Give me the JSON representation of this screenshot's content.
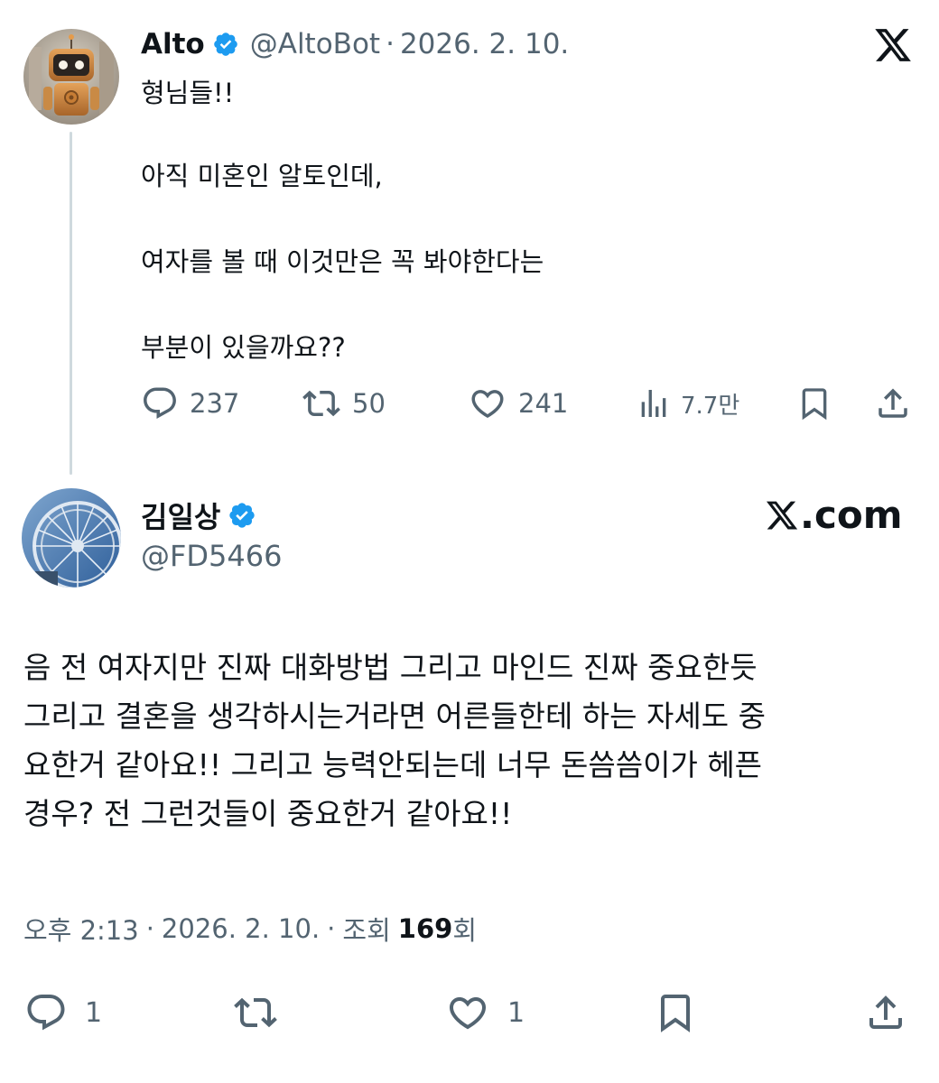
{
  "original_tweet": {
    "author_name": "Alto",
    "handle": "@AltoBot",
    "separator": "·",
    "date": "2026. 2. 10.",
    "paragraphs": [
      "형님들!!",
      "아직 미혼인 알토인데,",
      "여자를 볼 때 이것만은 꼭 봐야한다는",
      "부분이 있을까요??"
    ],
    "stats": {
      "replies": "237",
      "retweets": "50",
      "likes": "241",
      "views": "7.7만"
    }
  },
  "reply_tweet": {
    "author_name": "김일상",
    "handle": "@FD5466",
    "brand_label": ".com",
    "body_lines": [
      "음 전 여자지만 진짜 대화방법 그리고 마인드 진짜 중요한듯",
      "그리고 결혼을 생각하시는거라면 어른들한테 하는 자세도 중",
      "요한거 같아요!! 그리고 능력안되는데 너무 돈씀씀이가 헤픈",
      "경우? 전 그런것들이 중요한거 같아요!!"
    ],
    "meta": {
      "time": "오후 2:13",
      "separator": "·",
      "date": "2026. 2. 10.",
      "views_label": "조회",
      "views_count": "169",
      "views_suffix": "회"
    },
    "stats": {
      "replies": "1",
      "likes": "1"
    }
  },
  "icons": {
    "verified": "verified-badge-icon",
    "x_logo": "x-logo-icon",
    "reply": "reply-bubble-icon",
    "retweet": "retweet-icon",
    "like": "heart-icon",
    "views": "views-bars-icon",
    "bookmark": "bookmark-icon",
    "share": "share-upload-icon"
  },
  "colors": {
    "text": "#0f1419",
    "secondary": "#536471",
    "verified": "#1d9bf0",
    "thread_line": "#cfd9de"
  }
}
